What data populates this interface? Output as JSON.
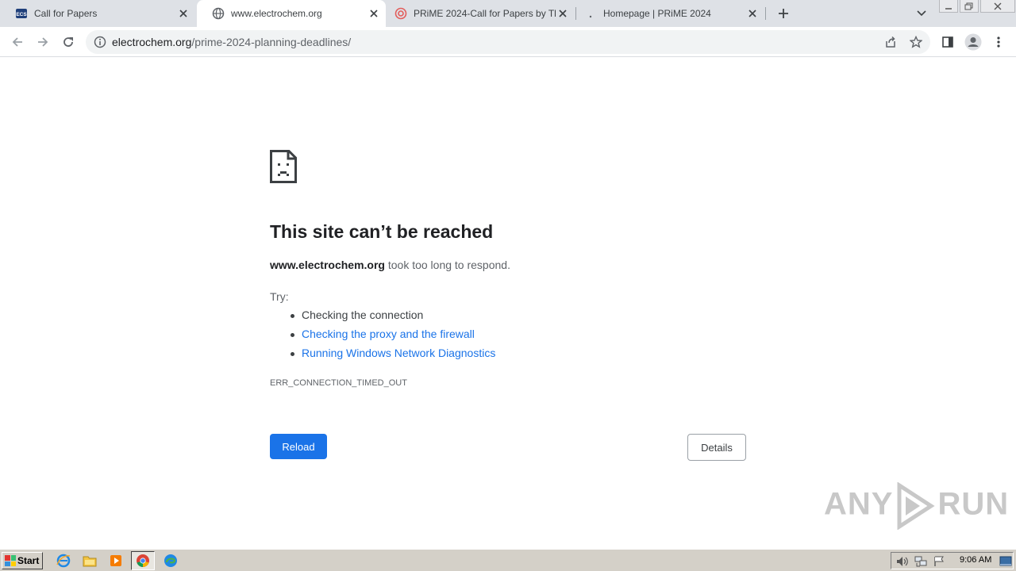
{
  "browser": {
    "tabs": [
      {
        "title": "Call for Papers",
        "favicon": "ecs-logo-icon",
        "active": false
      },
      {
        "title": "www.electrochem.org",
        "favicon": "globe-icon",
        "active": true
      },
      {
        "title": "PRiME 2024-Call for Papers by The E",
        "favicon": "prime-logo-icon",
        "active": false
      },
      {
        "title": "Homepage | PRiME 2024",
        "favicon": "loading-icon",
        "active": false
      }
    ],
    "url_host": "electrochem.org",
    "url_path": "/prime-2024-planning-deadlines/"
  },
  "error": {
    "heading": "This site can’t be reached",
    "host": "www.electrochem.org",
    "message_rest": " took too long to respond.",
    "try_label": "Try:",
    "suggestions": [
      "Checking the connection",
      "Checking the proxy and the firewall",
      "Running Windows Network Diagnostics"
    ],
    "error_code": "ERR_CONNECTION_TIMED_OUT",
    "reload_label": "Reload",
    "details_label": "Details"
  },
  "watermark": {
    "left": "ANY",
    "right": "RUN"
  },
  "taskbar": {
    "start_label": "Start",
    "clock": "9:06 AM"
  },
  "colors": {
    "accent": "#1a73e8",
    "tabstrip": "#dee1e6",
    "taskbar": "#d4d0c8"
  }
}
